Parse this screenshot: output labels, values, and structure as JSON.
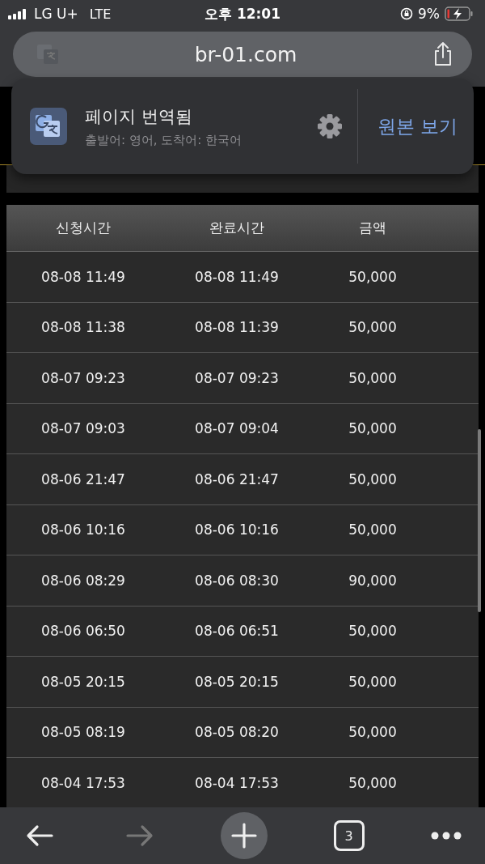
{
  "status_bar": {
    "carrier": "LG U+",
    "network": "LTE",
    "time": "오후 12:01",
    "battery": "9%"
  },
  "address_bar": {
    "url": "br-01.com"
  },
  "translate_popup": {
    "title": "페이지 번역됨",
    "subtitle": "출발어: 영어, 도착어: 한국어",
    "action": "원본 보기"
  },
  "table": {
    "columns": [
      "신청시간",
      "완료시간",
      "금액"
    ],
    "rows": [
      [
        "08-08 11:49",
        "08-08 11:49",
        "50,000"
      ],
      [
        "08-08 11:38",
        "08-08 11:39",
        "50,000"
      ],
      [
        "08-07 09:23",
        "08-07 09:23",
        "50,000"
      ],
      [
        "08-07 09:03",
        "08-07 09:04",
        "50,000"
      ],
      [
        "08-06 21:47",
        "08-06 21:47",
        "50,000"
      ],
      [
        "08-06 10:16",
        "08-06 10:16",
        "50,000"
      ],
      [
        "08-06 08:29",
        "08-06 08:30",
        "90,000"
      ],
      [
        "08-06 06:50",
        "08-06 06:51",
        "50,000"
      ],
      [
        "08-05 20:15",
        "08-05 20:15",
        "50,000"
      ],
      [
        "08-05 08:19",
        "08-05 08:20",
        "50,000"
      ],
      [
        "08-04 17:53",
        "08-04 17:53",
        "50,000"
      ]
    ]
  },
  "toolbar": {
    "back": {
      "disabled": false
    },
    "forward": {
      "disabled": true
    },
    "tab_count": "3"
  }
}
